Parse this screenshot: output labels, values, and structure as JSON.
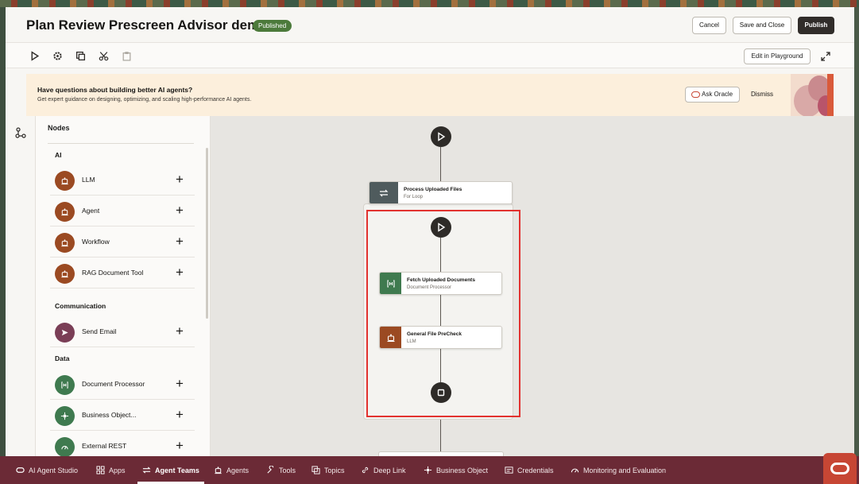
{
  "header": {
    "title": "Plan Review Prescreen Advisor demo",
    "status_badge": "Published",
    "cancel_label": "Cancel",
    "save_close_label": "Save and Close",
    "publish_label": "Publish"
  },
  "toolbar": {
    "tools": [
      "play-icon",
      "settings-icon",
      "copy-icon",
      "cut-icon",
      "paste-icon"
    ],
    "edit_playground_label": "Edit in Playground"
  },
  "banner": {
    "title": "Have questions about building better AI agents?",
    "subtitle": "Get expert guidance on designing, optimizing, and scaling high-performance AI agents.",
    "ask_label": "Ask Oracle",
    "dismiss_label": "Dismiss"
  },
  "nodes_panel": {
    "title": "Nodes",
    "sections": [
      {
        "name": "AI",
        "items": [
          {
            "label": "LLM",
            "icon": "robot-icon",
            "color": "#9b4a22"
          },
          {
            "label": "Agent",
            "icon": "robot-icon",
            "color": "#9b4a22"
          },
          {
            "label": "Workflow",
            "icon": "robot-icon",
            "color": "#9b4a22"
          },
          {
            "label": "RAG Document Tool",
            "icon": "robot-icon",
            "color": "#9b4a22"
          }
        ]
      },
      {
        "name": "Communication",
        "items": [
          {
            "label": "Send Email",
            "icon": "send-icon",
            "color": "#7a3e56"
          }
        ]
      },
      {
        "name": "Data",
        "items": [
          {
            "label": "Document Processor",
            "icon": "document-icon",
            "color": "#3f7a4f"
          },
          {
            "label": "Business Object...",
            "icon": "object-icon",
            "color": "#3f7a4f"
          },
          {
            "label": "External REST",
            "icon": "rest-icon",
            "color": "#3f7a4f"
          }
        ]
      }
    ]
  },
  "canvas": {
    "loop_node": {
      "title": "Process Uploaded Files",
      "subtitle": "For Loop"
    },
    "fetch_node": {
      "title": "Fetch Uploaded Documents",
      "subtitle": "Document Processor"
    },
    "precheck_node": {
      "title": "General File PreCheck",
      "subtitle": "LLM"
    }
  },
  "bottom_nav": {
    "items": [
      {
        "label": "AI Agent Studio",
        "icon": "oracle-icon"
      },
      {
        "label": "Apps",
        "icon": "apps-icon"
      },
      {
        "label": "Agent Teams",
        "icon": "teams-icon",
        "active": true
      },
      {
        "label": "Agents",
        "icon": "agent-icon"
      },
      {
        "label": "Tools",
        "icon": "tools-icon"
      },
      {
        "label": "Topics",
        "icon": "topics-icon"
      },
      {
        "label": "Deep Link",
        "icon": "link-icon"
      },
      {
        "label": "Business Object",
        "icon": "object-icon"
      },
      {
        "label": "Credentials",
        "icon": "credentials-icon"
      },
      {
        "label": "Monitoring and Evaluation",
        "icon": "monitor-icon"
      }
    ]
  },
  "colors": {
    "bottom_bar": "#6b2a36",
    "ai_node": "#9b4a22",
    "data_node": "#3f7a4f",
    "published": "#4c7a3b",
    "highlight": "#e2322f",
    "oracle_red": "#c74634"
  }
}
